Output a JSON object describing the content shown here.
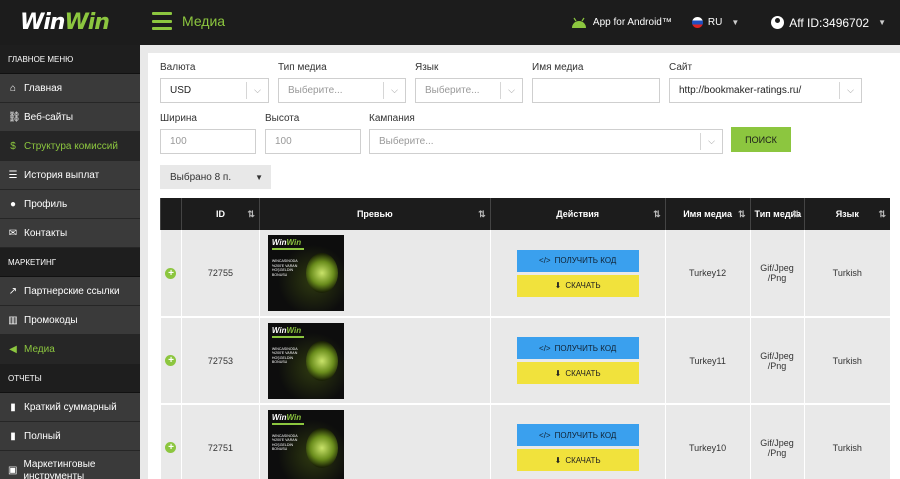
{
  "app": {
    "logo_a": "Win",
    "logo_b": "Win"
  },
  "header": {
    "title": "Медиа",
    "android_label": "App for Android™",
    "lang": "RU",
    "aff_id": "Aff ID:3496702"
  },
  "sidebar": {
    "sections": [
      "ГЛАВНОЕ МЕНЮ",
      "МАРКЕТИНГ",
      "ОТЧЕТЫ"
    ],
    "items": [
      {
        "label": "Главная",
        "icon": "home-icon",
        "glyph": "⌂"
      },
      {
        "label": "Веб-сайты",
        "icon": "link-icon",
        "glyph": "⛓"
      },
      {
        "label": "Структура комиссий",
        "icon": "dollar-icon",
        "glyph": "$"
      },
      {
        "label": "История выплат",
        "icon": "list-icon",
        "glyph": "☰"
      },
      {
        "label": "Профиль",
        "icon": "user-icon",
        "glyph": "👤"
      },
      {
        "label": "Контакты",
        "icon": "envelope-icon",
        "glyph": "✉"
      },
      {
        "label": "Партнерские ссылки",
        "icon": "external-link-icon",
        "glyph": "↗"
      },
      {
        "label": "Промокоды",
        "icon": "barcode-icon",
        "glyph": "▥"
      },
      {
        "label": "Медиа",
        "icon": "megaphone-icon",
        "glyph": "📣"
      },
      {
        "label": "Краткий суммарный",
        "icon": "chart-icon",
        "glyph": "▮"
      },
      {
        "label": "Полный",
        "icon": "bar-chart-icon",
        "glyph": "▮"
      },
      {
        "label": "Маркетинговые инструменты",
        "icon": "tools-icon",
        "glyph": "▣"
      }
    ]
  },
  "filters": {
    "currency_label": "Валюта",
    "currency_value": "USD",
    "media_type_label": "Тип медиа",
    "media_type_placeholder": "Выберите...",
    "language_label": "Язык",
    "language_placeholder": "Выберите...",
    "media_name_label": "Имя медиа",
    "media_name_value": "",
    "site_label": "Сайт",
    "site_value": "http://bookmaker-ratings.ru/",
    "width_label": "Ширина",
    "width_placeholder": "100",
    "height_label": "Высота",
    "height_placeholder": "100",
    "campaign_label": "Кампания",
    "campaign_placeholder": "Выберите...",
    "search_button": "ПОИСК",
    "selected_label": "Выбрано 8 п."
  },
  "table": {
    "headers": {
      "id": "ID",
      "preview": "Превью",
      "actions": "Действия",
      "name": "Имя медиа",
      "type": "Тип медиа",
      "lang": "Язык"
    },
    "get_code": "ПОЛУЧИТЬ КОД",
    "download": "СКАЧАТЬ",
    "thumb_text": "WINCASINODA %200'E VARAN HOŞGELDİN BONUSU",
    "rows": [
      {
        "id": "72755",
        "name": "Turkey12",
        "type": "Gif/Jpeg /Png",
        "lang": "Turkish"
      },
      {
        "id": "72753",
        "name": "Turkey11",
        "type": "Gif/Jpeg /Png",
        "lang": "Turkish"
      },
      {
        "id": "72751",
        "name": "Turkey10",
        "type": "Gif/Jpeg /Png",
        "lang": "Turkish"
      }
    ]
  },
  "colors": {
    "accent": "#8cc63f",
    "code_button": "#3aa0ee",
    "download_button": "#f1e23c",
    "dark": "#1c1c1c"
  }
}
